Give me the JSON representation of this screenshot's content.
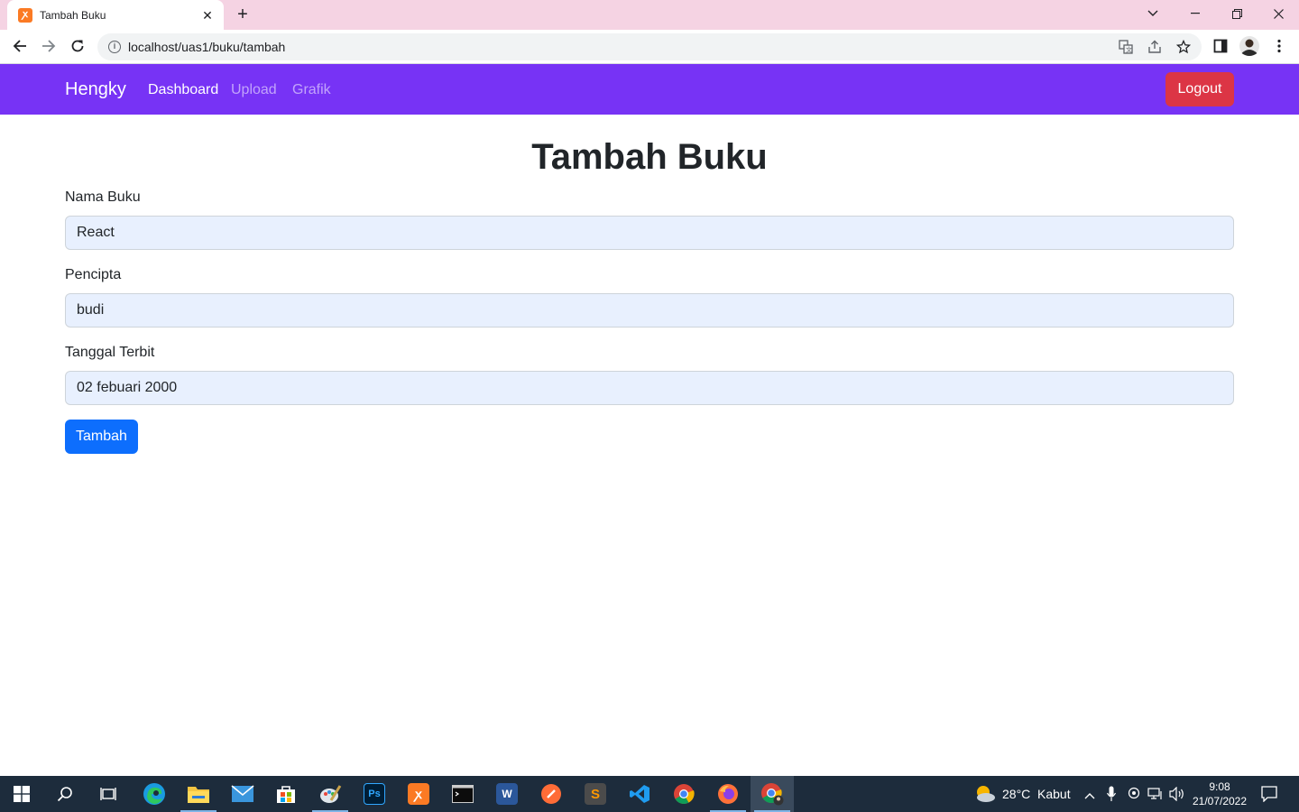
{
  "browser": {
    "tab_title": "Tambah Buku",
    "tab_favicon": "xampp-icon",
    "address": "localhost/uas1/buku/tambah"
  },
  "navbar": {
    "brand": "Hengky",
    "links": [
      "Dashboard",
      "Upload",
      "Grafik"
    ],
    "active_link": "Dashboard",
    "logout_label": "Logout",
    "bg_color": "#7733f5"
  },
  "form": {
    "title": "Tambah Buku",
    "fields": [
      {
        "label": "Nama Buku",
        "value": "React"
      },
      {
        "label": "Pencipta",
        "value": "budi"
      },
      {
        "label": "Tanggal Terbit",
        "value": "02 febuari 2000"
      }
    ],
    "submit_label": "Tambah"
  },
  "taskbar": {
    "apps": [
      "start-icon",
      "search-icon",
      "task-view-icon",
      "edge-icon",
      "file-explorer-icon",
      "mail-icon",
      "store-icon",
      "paint-icon",
      "photoshop-icon",
      "xampp-icon",
      "terminal-icon",
      "word-icon",
      "postman-icon",
      "sublime-icon",
      "vscode-icon",
      "chrome-icon",
      "firefox-icon",
      "chrome-profile-icon"
    ],
    "weather_temp": "28°C",
    "weather_desc": "Kabut",
    "time": "9:08",
    "date": "21/07/2022"
  }
}
